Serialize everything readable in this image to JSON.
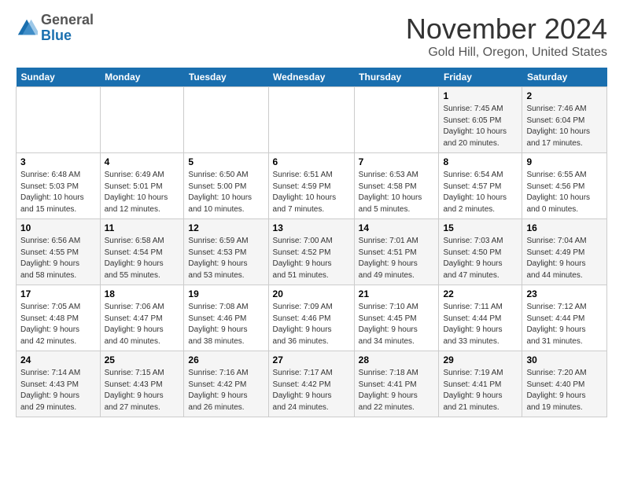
{
  "header": {
    "logo_line1": "General",
    "logo_line2": "Blue",
    "month_title": "November 2024",
    "location": "Gold Hill, Oregon, United States"
  },
  "weekdays": [
    "Sunday",
    "Monday",
    "Tuesday",
    "Wednesday",
    "Thursday",
    "Friday",
    "Saturday"
  ],
  "weeks": [
    [
      {
        "day": "",
        "info": ""
      },
      {
        "day": "",
        "info": ""
      },
      {
        "day": "",
        "info": ""
      },
      {
        "day": "",
        "info": ""
      },
      {
        "day": "",
        "info": ""
      },
      {
        "day": "1",
        "info": "Sunrise: 7:45 AM\nSunset: 6:05 PM\nDaylight: 10 hours\nand 20 minutes."
      },
      {
        "day": "2",
        "info": "Sunrise: 7:46 AM\nSunset: 6:04 PM\nDaylight: 10 hours\nand 17 minutes."
      }
    ],
    [
      {
        "day": "3",
        "info": "Sunrise: 6:48 AM\nSunset: 5:03 PM\nDaylight: 10 hours\nand 15 minutes."
      },
      {
        "day": "4",
        "info": "Sunrise: 6:49 AM\nSunset: 5:01 PM\nDaylight: 10 hours\nand 12 minutes."
      },
      {
        "day": "5",
        "info": "Sunrise: 6:50 AM\nSunset: 5:00 PM\nDaylight: 10 hours\nand 10 minutes."
      },
      {
        "day": "6",
        "info": "Sunrise: 6:51 AM\nSunset: 4:59 PM\nDaylight: 10 hours\nand 7 minutes."
      },
      {
        "day": "7",
        "info": "Sunrise: 6:53 AM\nSunset: 4:58 PM\nDaylight: 10 hours\nand 5 minutes."
      },
      {
        "day": "8",
        "info": "Sunrise: 6:54 AM\nSunset: 4:57 PM\nDaylight: 10 hours\nand 2 minutes."
      },
      {
        "day": "9",
        "info": "Sunrise: 6:55 AM\nSunset: 4:56 PM\nDaylight: 10 hours\nand 0 minutes."
      }
    ],
    [
      {
        "day": "10",
        "info": "Sunrise: 6:56 AM\nSunset: 4:55 PM\nDaylight: 9 hours\nand 58 minutes."
      },
      {
        "day": "11",
        "info": "Sunrise: 6:58 AM\nSunset: 4:54 PM\nDaylight: 9 hours\nand 55 minutes."
      },
      {
        "day": "12",
        "info": "Sunrise: 6:59 AM\nSunset: 4:53 PM\nDaylight: 9 hours\nand 53 minutes."
      },
      {
        "day": "13",
        "info": "Sunrise: 7:00 AM\nSunset: 4:52 PM\nDaylight: 9 hours\nand 51 minutes."
      },
      {
        "day": "14",
        "info": "Sunrise: 7:01 AM\nSunset: 4:51 PM\nDaylight: 9 hours\nand 49 minutes."
      },
      {
        "day": "15",
        "info": "Sunrise: 7:03 AM\nSunset: 4:50 PM\nDaylight: 9 hours\nand 47 minutes."
      },
      {
        "day": "16",
        "info": "Sunrise: 7:04 AM\nSunset: 4:49 PM\nDaylight: 9 hours\nand 44 minutes."
      }
    ],
    [
      {
        "day": "17",
        "info": "Sunrise: 7:05 AM\nSunset: 4:48 PM\nDaylight: 9 hours\nand 42 minutes."
      },
      {
        "day": "18",
        "info": "Sunrise: 7:06 AM\nSunset: 4:47 PM\nDaylight: 9 hours\nand 40 minutes."
      },
      {
        "day": "19",
        "info": "Sunrise: 7:08 AM\nSunset: 4:46 PM\nDaylight: 9 hours\nand 38 minutes."
      },
      {
        "day": "20",
        "info": "Sunrise: 7:09 AM\nSunset: 4:46 PM\nDaylight: 9 hours\nand 36 minutes."
      },
      {
        "day": "21",
        "info": "Sunrise: 7:10 AM\nSunset: 4:45 PM\nDaylight: 9 hours\nand 34 minutes."
      },
      {
        "day": "22",
        "info": "Sunrise: 7:11 AM\nSunset: 4:44 PM\nDaylight: 9 hours\nand 33 minutes."
      },
      {
        "day": "23",
        "info": "Sunrise: 7:12 AM\nSunset: 4:44 PM\nDaylight: 9 hours\nand 31 minutes."
      }
    ],
    [
      {
        "day": "24",
        "info": "Sunrise: 7:14 AM\nSunset: 4:43 PM\nDaylight: 9 hours\nand 29 minutes."
      },
      {
        "day": "25",
        "info": "Sunrise: 7:15 AM\nSunset: 4:43 PM\nDaylight: 9 hours\nand 27 minutes."
      },
      {
        "day": "26",
        "info": "Sunrise: 7:16 AM\nSunset: 4:42 PM\nDaylight: 9 hours\nand 26 minutes."
      },
      {
        "day": "27",
        "info": "Sunrise: 7:17 AM\nSunset: 4:42 PM\nDaylight: 9 hours\nand 24 minutes."
      },
      {
        "day": "28",
        "info": "Sunrise: 7:18 AM\nSunset: 4:41 PM\nDaylight: 9 hours\nand 22 minutes."
      },
      {
        "day": "29",
        "info": "Sunrise: 7:19 AM\nSunset: 4:41 PM\nDaylight: 9 hours\nand 21 minutes."
      },
      {
        "day": "30",
        "info": "Sunrise: 7:20 AM\nSunset: 4:40 PM\nDaylight: 9 hours\nand 19 minutes."
      }
    ]
  ]
}
